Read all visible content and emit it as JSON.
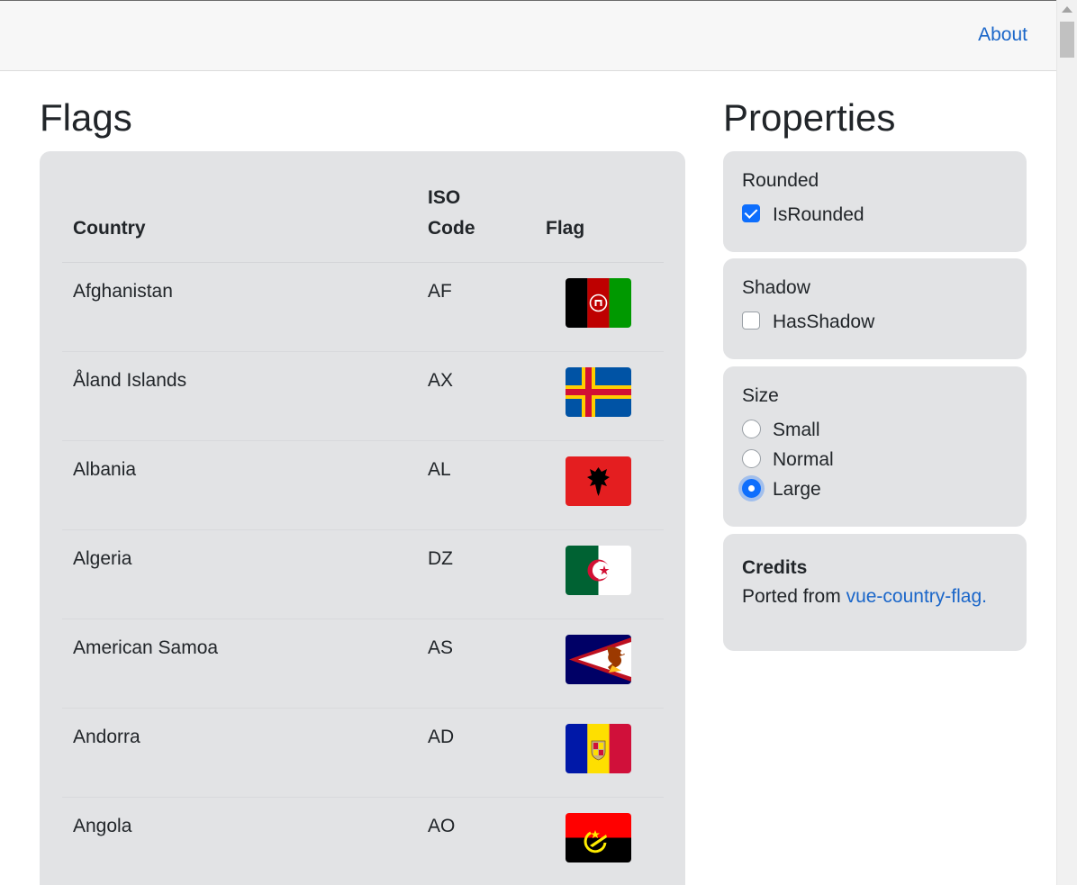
{
  "nav": {
    "about_label": "About"
  },
  "left": {
    "title": "Flags",
    "table": {
      "headers": {
        "country": "Country",
        "iso_line1": "ISO",
        "iso_line2": "Code",
        "flag": "Flag"
      },
      "rows": [
        {
          "country": "Afghanistan",
          "iso": "AF",
          "flag_icon": "afghanistan-flag-icon"
        },
        {
          "country": "Åland Islands",
          "iso": "AX",
          "flag_icon": "aland-islands-flag-icon"
        },
        {
          "country": "Albania",
          "iso": "AL",
          "flag_icon": "albania-flag-icon"
        },
        {
          "country": "Algeria",
          "iso": "DZ",
          "flag_icon": "algeria-flag-icon"
        },
        {
          "country": "American Samoa",
          "iso": "AS",
          "flag_icon": "american-samoa-flag-icon"
        },
        {
          "country": "Andorra",
          "iso": "AD",
          "flag_icon": "andorra-flag-icon"
        },
        {
          "country": "Angola",
          "iso": "AO",
          "flag_icon": "angola-flag-icon"
        }
      ]
    }
  },
  "right": {
    "title": "Properties",
    "rounded": {
      "title": "Rounded",
      "option_label": "IsRounded",
      "checked": true
    },
    "shadow": {
      "title": "Shadow",
      "option_label": "HasShadow",
      "checked": false
    },
    "size": {
      "title": "Size",
      "options": [
        "Small",
        "Normal",
        "Large"
      ],
      "selected": "Large"
    },
    "credits": {
      "title": "Credits",
      "text": "Ported from",
      "link_label": "vue-country-flag."
    }
  },
  "colors": {
    "link": "#1a66c9",
    "card_bg": "#e2e3e5",
    "accent": "#0d6efd"
  }
}
